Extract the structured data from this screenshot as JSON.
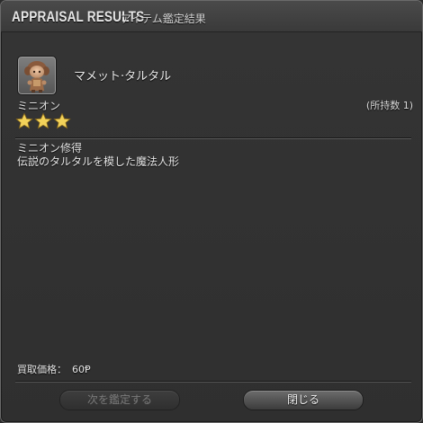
{
  "window": {
    "title": "APPRAISAL RESULTS",
    "subtitle": "アイテム鑑定結果"
  },
  "item": {
    "icon": "mammet-tarutaru-icon",
    "name": "マメット·タルタル",
    "category": "ミニオン",
    "owned": "(所持数 1)",
    "rating_stars": 3,
    "description_lines": [
      "ミニオン修得",
      "伝説のタルタルを模した魔法人形"
    ]
  },
  "price": {
    "label": "買取価格：",
    "value": "60"
  },
  "buttons": {
    "next_label": "次を鑑定する",
    "close_label": "閉じる"
  },
  "colors": {
    "star": "#f2d25a",
    "panel": "#2f2f2f",
    "text": "#e6e6e6"
  }
}
